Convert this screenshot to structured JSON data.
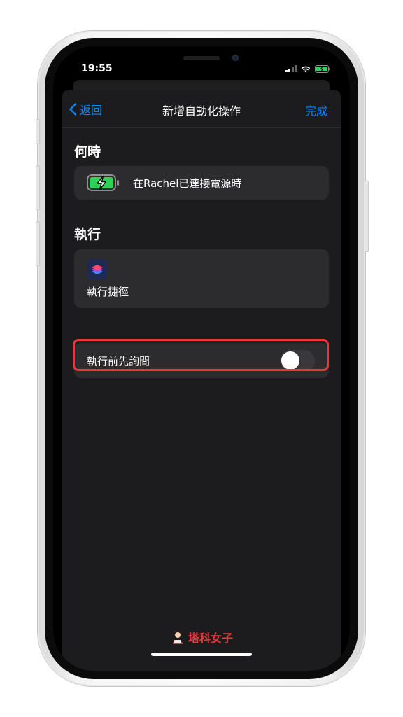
{
  "status_bar": {
    "time": "19:55"
  },
  "navbar": {
    "back_label": "返回",
    "title": "新增自動化操作",
    "done_label": "完成"
  },
  "when_section": {
    "title": "何時",
    "trigger_text": "在Rachel已連接電源時"
  },
  "do_section": {
    "title": "執行",
    "action_label": "執行捷徑"
  },
  "ask_before_running": {
    "label": "執行前先詢問",
    "enabled": false
  },
  "watermark": {
    "text": "塔科女子"
  },
  "colors": {
    "accent": "#0a84ff",
    "highlight": "#e8383d",
    "battery_green": "#30d158"
  }
}
